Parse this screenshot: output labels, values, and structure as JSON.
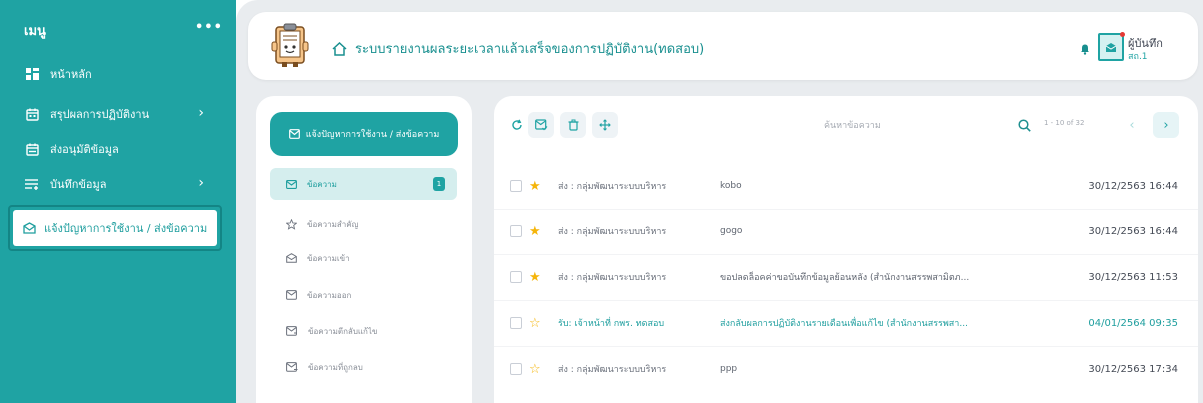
{
  "sidebar": {
    "title": "เมนู",
    "more": "•••",
    "items": [
      {
        "label": "หน้าหลัก",
        "icon": "dashboard-icon"
      },
      {
        "label": "สรุปผลการปฏิบัติงาน",
        "icon": "calendar-icon",
        "chevron": "›"
      },
      {
        "label": "ส่งอนุมัติข้อมูล",
        "icon": "calendar-icon"
      },
      {
        "label": "บันทึกข้อมูล",
        "icon": "list-add-icon",
        "chevron": "›"
      }
    ],
    "active_item": "แจ้งปัญหาการใช้งาน / ส่งข้อความ"
  },
  "header": {
    "title": "ระบบรายงานผลระยะเวลาแล้วเสร็จของการปฏิบัติงาน(ทดสอบ)",
    "user_name": "ผู้บันทึก",
    "user_sub": "สถ.1"
  },
  "mail_nav": {
    "compose_label": "แจ้งปัญหาการใช้งาน / ส่งข้อความ",
    "folders": [
      {
        "label": "ข้อความ",
        "icon": "mail-icon",
        "badge": "1",
        "active": true
      },
      {
        "label": "ข้อความสำคัญ",
        "icon": "star-outline-icon"
      },
      {
        "label": "ข้อความเข้า",
        "icon": "inbox-icon"
      },
      {
        "label": "ข้อความออก",
        "icon": "outbox-icon"
      },
      {
        "label": "ข้อความตีกลับแก้ไข",
        "icon": "mail-return-icon"
      },
      {
        "label": "ข้อความที่ถูกลบ",
        "icon": "mail-trash-icon"
      }
    ]
  },
  "toolbar": {
    "search_placeholder": "ค้นหาข้อความ",
    "pager": "1 - 10 of 32",
    "prev": "‹",
    "next": "›"
  },
  "messages": [
    {
      "sender": "ส่ง : กลุ่มพัฒนาระบบบริหาร",
      "subject": "kobo",
      "date": "30/12/2563 16:44",
      "star": "★",
      "starred": true
    },
    {
      "sender": "ส่ง : กลุ่มพัฒนาระบบบริหาร",
      "subject": "gogo",
      "date": "30/12/2563 16:44",
      "star": "★",
      "starred": true
    },
    {
      "sender": "ส่ง : กลุ่มพัฒนาระบบบริหาร",
      "subject": "ขอปลดล็อคค่าขอบันทึกข้อมูลย้อนหลัง (สำนักงานสรรพสามิตภ...",
      "date": "30/12/2563 11:53",
      "star": "★",
      "starred": true
    },
    {
      "sender": "รับ: เจ้าหน้าที่ กพร. ทดสอบ",
      "subject": "ส่งกลับผลการปฏิบัติงานรายเดือนเพื่อแก้ไข (สำนักงานสรรพสา...",
      "date": "04/01/2564 09:35",
      "star": "☆",
      "starred": false,
      "highlight": true
    },
    {
      "sender": "ส่ง : กลุ่มพัฒนาระบบบริหาร",
      "subject": "ppp",
      "date": "30/12/2563 17:34",
      "star": "☆",
      "starred": false
    }
  ],
  "colors": {
    "accent": "#1fa3a3",
    "star": "#f5b50a",
    "background": "#e9ecef"
  }
}
